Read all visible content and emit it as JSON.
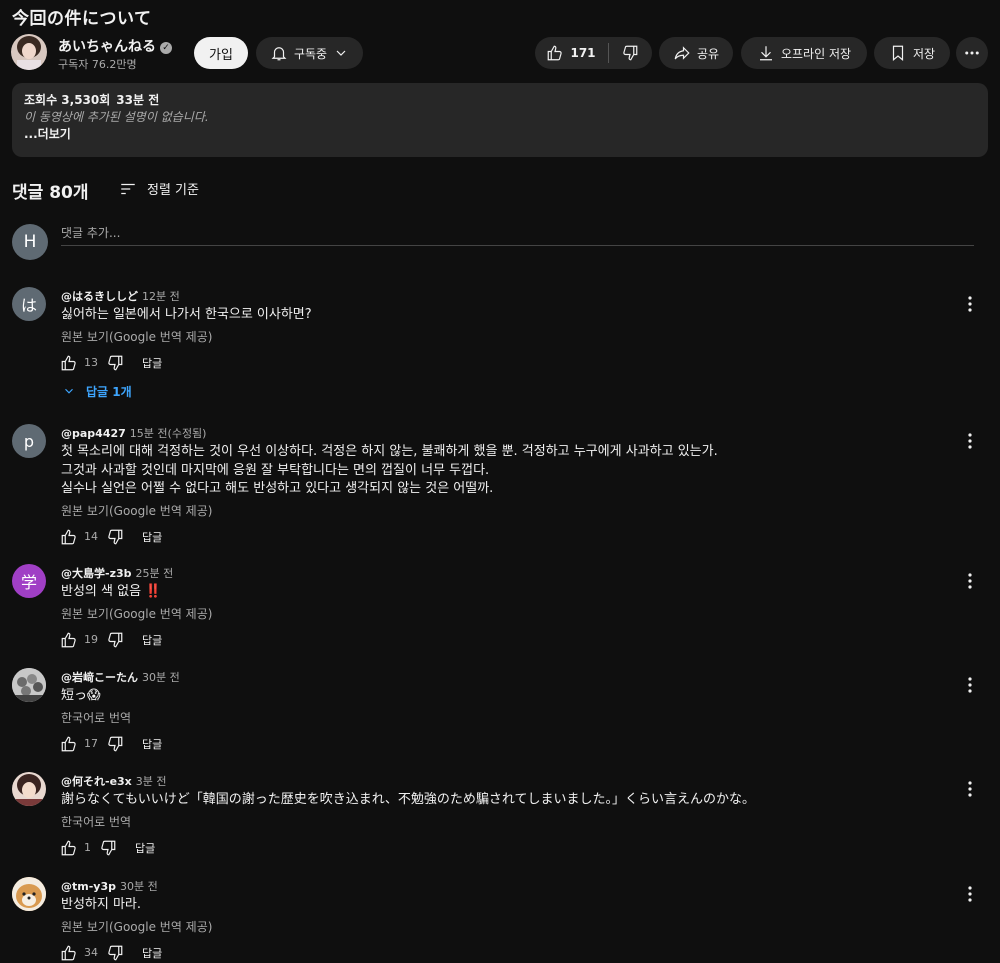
{
  "video": {
    "title": "今回の件について",
    "channel_name": "あいちゃんねる",
    "subscribers": "구독자 76.2만명",
    "join_label": "가입",
    "subscribed_label": "구독중",
    "likes": "171",
    "share_label": "공유",
    "offline_label": "오프라인 저장",
    "save_label": "저장"
  },
  "description": {
    "views": "조회수 3,530회",
    "time": "33분 전",
    "empty_text": "이 동영상에 추가된 설명이 없습니다.",
    "more": "...더보기"
  },
  "comments_header": {
    "count": "댓글 80개",
    "sort_label": "정렬 기준",
    "my_initial": "H",
    "add_placeholder": "댓글 추가..."
  },
  "comments": [
    {
      "avatar_letter": "は",
      "avatar_color": "#5f6a73",
      "author": "@はるきししど",
      "time": "12분 전",
      "lines": [
        "싫어하는 일본에서 나가서 한국으로 이사하면?"
      ],
      "translation": "원본 보기(Google 번역 제공)",
      "likes": "13",
      "reply_label": "답글",
      "replies": "답글 1개"
    },
    {
      "avatar_letter": "p",
      "avatar_color": "#5f6a73",
      "author": "@pap4427",
      "time": "15분 전(수정됨)",
      "lines": [
        "첫 목소리에 대해 걱정하는 것이 우선 이상하다. 걱정은 하지 않는, 불쾌하게 했을 뿐. 걱정하고 누구에게 사과하고 있는가.",
        "그것과 사과할 것인데 마지막에 응원 잘 부탁합니다는 면의 껍질이 너무 두껍다.",
        "실수나 실언은 어쩔 수 없다고 해도 반성하고 있다고 생각되지 않는 것은 어떨까."
      ],
      "translation": "원본 보기(Google 번역 제공)",
      "likes": "14",
      "reply_label": "답글"
    },
    {
      "avatar_letter": "学",
      "avatar_color": "#a03fc5",
      "author": "@大島学-z3b",
      "time": "25분 전",
      "lines": [
        "반성의 색 없음 ‼️"
      ],
      "translation": "원본 보기(Google 번역 제공)",
      "likes": "19",
      "reply_label": "답글"
    },
    {
      "avatar_letter": "",
      "avatar_color": "#cfcfcf",
      "author": "@岩﨑こーたん",
      "time": "30분 전",
      "lines": [
        "短っ😱"
      ],
      "translation": "한국어로 번역",
      "likes": "17",
      "reply_label": "답글"
    },
    {
      "avatar_letter": "",
      "avatar_color": "#3a2a28",
      "author": "@何それ-e3x",
      "time": "3분 전",
      "lines": [
        "謝らなくてもいいけど「韓国の謝った歴史を吹き込まれ、不勉強のため騙されてしまいました。」くらい言えんのかな。"
      ],
      "translation": "한국어로 번역",
      "likes": "1",
      "reply_label": "답글"
    },
    {
      "avatar_letter": "",
      "avatar_color": "#d9a260",
      "author": "@tm-y3p",
      "time": "30분 전",
      "lines": [
        "반성하지 마라."
      ],
      "translation": "원본 보기(Google 번역 제공)",
      "likes": "34",
      "reply_label": "답글"
    }
  ]
}
